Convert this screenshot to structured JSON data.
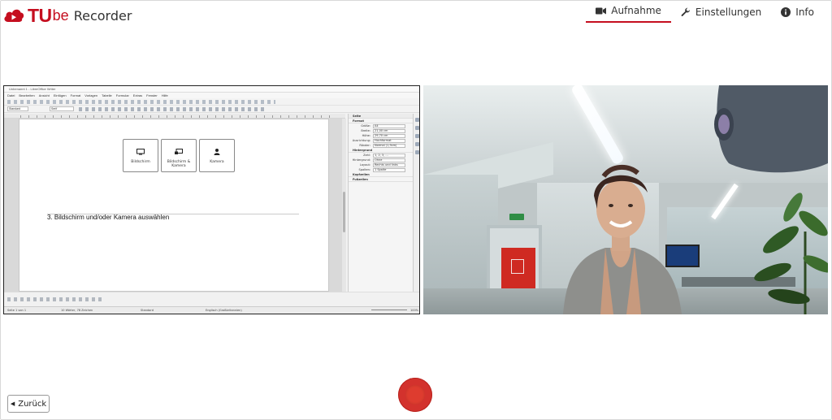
{
  "app": {
    "logo_tu": "TU",
    "logo_be": "be",
    "logo_recorder": "Recorder"
  },
  "nav": {
    "items": [
      {
        "label": "Aufnahme",
        "icon": "video-camera-icon",
        "active": true
      },
      {
        "label": "Einstellungen",
        "icon": "wrench-icon",
        "active": false
      },
      {
        "label": "Info",
        "icon": "info-icon",
        "active": false
      }
    ]
  },
  "screen_share": {
    "window_title": "Unbenannt 1 - LibreOffice Writer",
    "menu": [
      "Datei",
      "Bearbeiten",
      "Ansicht",
      "Einfügen",
      "Format",
      "Vorlagen",
      "Tabelle",
      "Formular",
      "Extras",
      "Fenster",
      "Hilfe"
    ],
    "style_box": "Standard",
    "font_box": "Serif",
    "page_buttons": [
      {
        "label": "Bildschirm",
        "icon": "monitor-icon"
      },
      {
        "label": "Bildschirm & Kamera",
        "icon": "monitor-camera-icon"
      },
      {
        "label": "Kamera",
        "icon": "person-icon"
      }
    ],
    "page_text": "3. Bildschirm und/oder Kamera auswählen",
    "sidebar": {
      "header": "Seite",
      "sections": [
        "Format",
        "Hintergrund",
        "Kopfzeilen",
        "Fußzeilen"
      ],
      "format_rows": [
        {
          "label": "Größe:",
          "value": "A4"
        },
        {
          "label": "Breite:",
          "value": "21,00 cm"
        },
        {
          "label": "Höhe:",
          "value": "29,70 cm"
        },
        {
          "label": "Ausrichtung:",
          "value": "Hochformat"
        },
        {
          "label": "Ränder:",
          "value": "Normal (1,9cm)"
        }
      ],
      "layout_rows": [
        {
          "label": "Zahl:",
          "value": "1, 2, 3, ..."
        },
        {
          "label": "Hintergrund:",
          "value": "Ohne"
        },
        {
          "label": "Layout:",
          "value": "Rechts und links"
        },
        {
          "label": "Spalten:",
          "value": "1 Spalte"
        }
      ]
    },
    "status": {
      "page": "Seite 1 von 1",
      "words": "10 Wörter, 78 Zeichen",
      "style": "Standard",
      "language": "Englisch (Großbritannien)",
      "zoom": "100%"
    }
  },
  "controls": {
    "back_label": "Zurück",
    "record_icon": "record-icon"
  },
  "colors": {
    "brand_red": "#c50e1f",
    "record_red": "#d3322d"
  }
}
